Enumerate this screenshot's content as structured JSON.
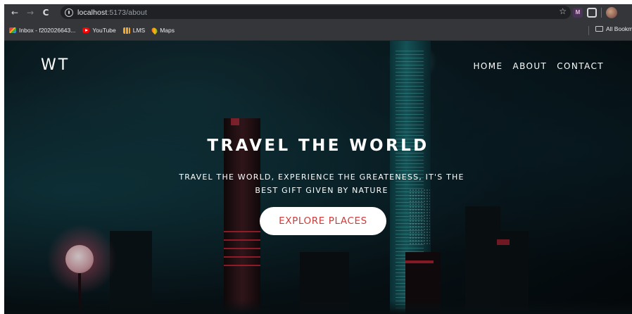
{
  "browser": {
    "url_host": "localhost",
    "url_path": ":5173/about",
    "icons": {
      "back": "←",
      "forward": "→",
      "reload": "C",
      "star": "☆",
      "ext": "M"
    },
    "bookmarks": [
      {
        "label": "Inbox - f202026643...",
        "icon": "gmail-icon"
      },
      {
        "label": "YouTube",
        "icon": "youtube-icon"
      },
      {
        "label": "LMS",
        "icon": "lms-icon"
      },
      {
        "label": "Maps",
        "icon": "maps-icon"
      }
    ],
    "all_bookmarks": "All Bookm"
  },
  "page": {
    "brand": "WT",
    "nav": [
      "HOME",
      "ABOUT",
      "CONTACT"
    ],
    "headline": "TRAVEL THE WORLD",
    "subhead": "TRAVEL THE WORLD, EXPERIENCE THE GREATENESS, IT'S THE BEST GIFT GIVEN BY NATURE",
    "cta": "EXPLORE PLACES"
  },
  "colors": {
    "cta_text": "#d03a3a",
    "browser_chrome": "#35363a",
    "hero_bg": "#0a1a20"
  }
}
